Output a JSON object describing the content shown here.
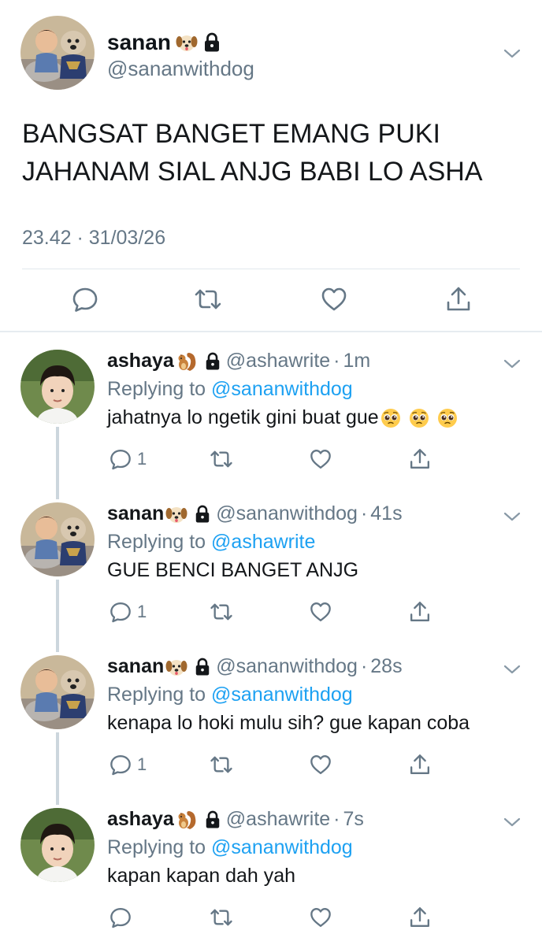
{
  "main_tweet": {
    "name": "sanan",
    "handle": "@sananwithdog",
    "text_line1": "BANGSAT BANGET EMANG PUKI",
    "text_line2": "JAHANAM SIAL ANJG BABI LO ASHA",
    "timestamp": "23.42 · 31/03/26"
  },
  "replies": [
    {
      "name": "ashaya",
      "handle": "@ashawrite",
      "time": "1m",
      "replying_label": "Replying to",
      "replying_to": "@sananwithdog",
      "text": "jahatnya lo ngetik gini buat gue",
      "reply_count": "1",
      "emoji": "squirrel"
    },
    {
      "name": "sanan",
      "handle": "@sananwithdog",
      "time": "41s",
      "replying_label": "Replying to",
      "replying_to": "@ashawrite",
      "text": "GUE BENCI BANGET ANJG",
      "reply_count": "1",
      "emoji": "dog"
    },
    {
      "name": "sanan",
      "handle": "@sananwithdog",
      "time": "28s",
      "replying_label": "Replying to",
      "replying_to": "@sananwithdog",
      "text": "kenapa lo hoki mulu sih? gue kapan coba",
      "reply_count": "1",
      "emoji": "dog"
    },
    {
      "name": "ashaya",
      "handle": "@ashawrite",
      "time": "7s",
      "replying_label": "Replying to",
      "replying_to": "@sananwithdog",
      "text": "kapan kapan dah yah",
      "reply_count": "",
      "emoji": "squirrel"
    }
  ],
  "icons": [
    "dog-face-emoji",
    "lock-icon",
    "squirrel-emoji",
    "pleading-face-emoji",
    "chevron-down-icon",
    "reply-icon",
    "retweet-icon",
    "like-icon",
    "share-icon"
  ],
  "colors": {
    "link": "#1da1f2",
    "secondary": "#657786",
    "icon": "#657786",
    "divider": "#e1e8ed",
    "thread_line": "#ccd6dd"
  }
}
